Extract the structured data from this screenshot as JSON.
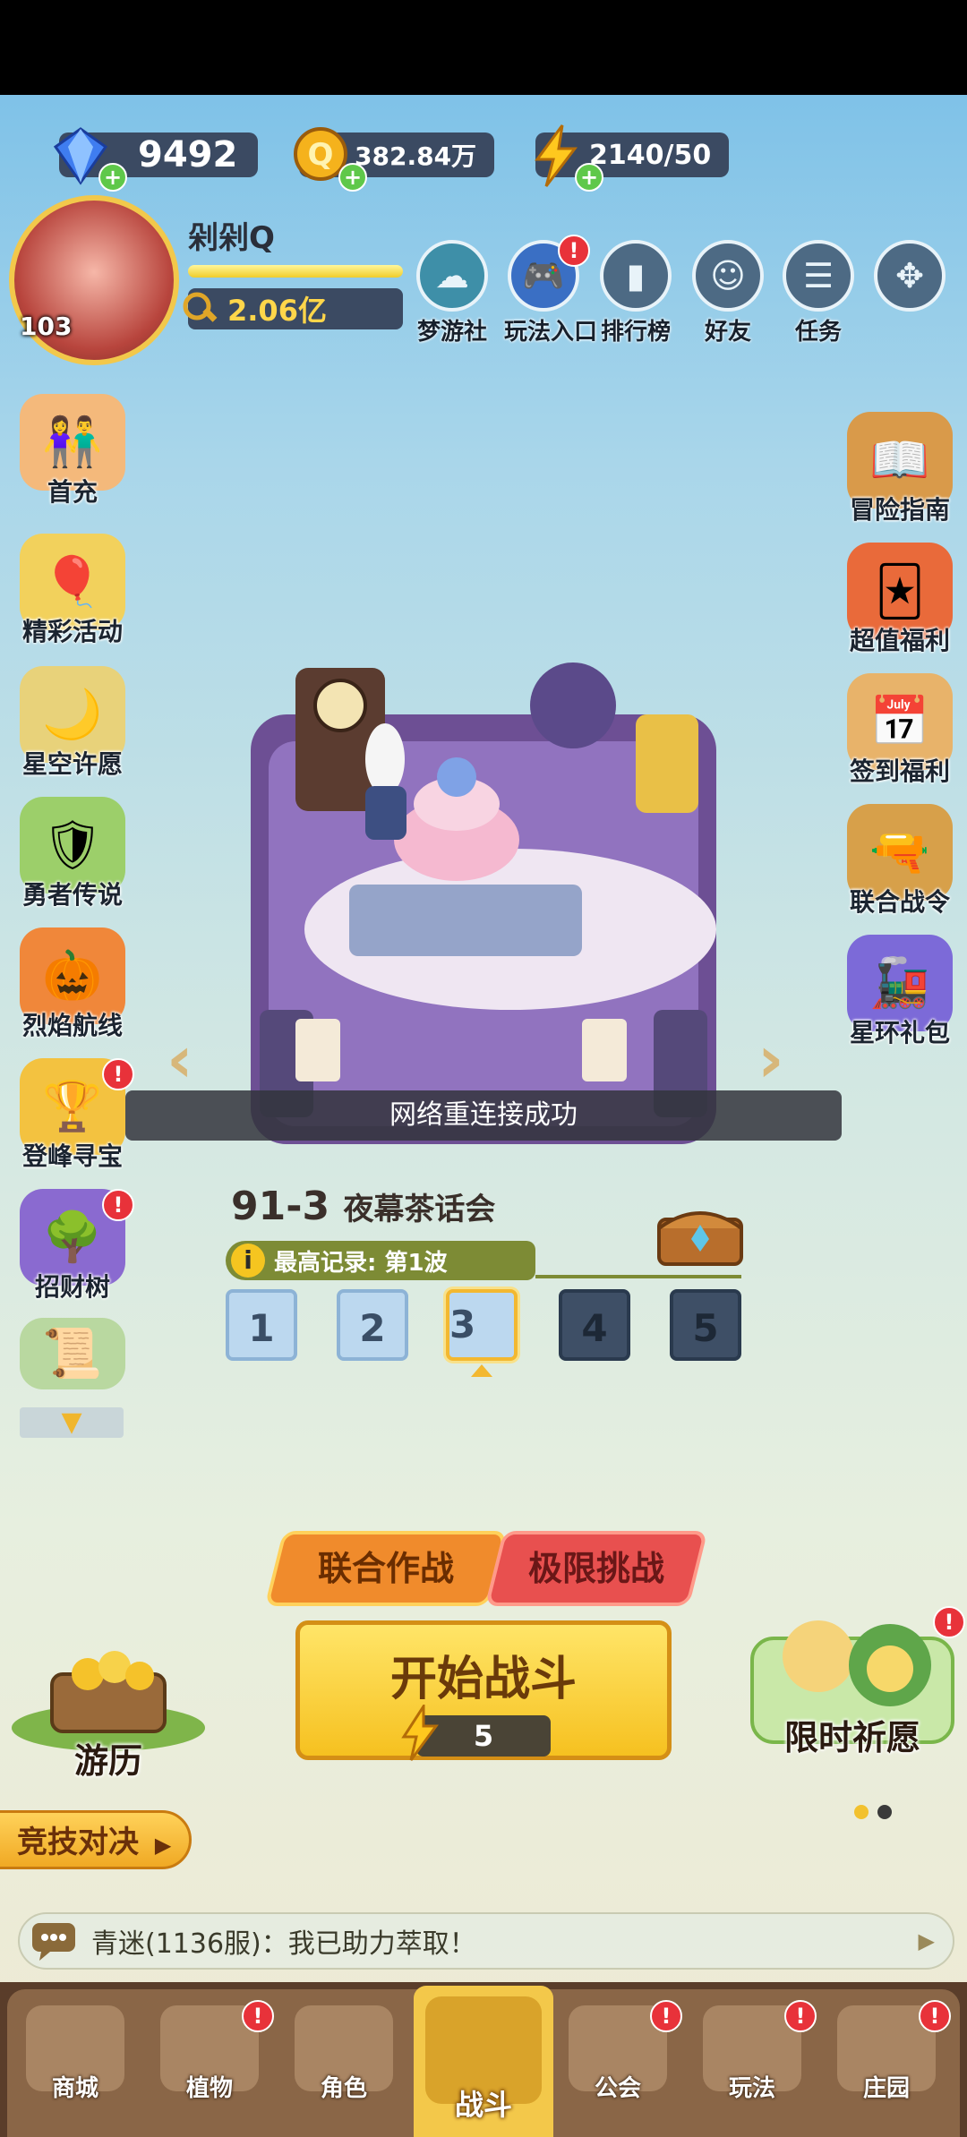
{
  "currencies": {
    "gems": "9492",
    "coins": "382.84万",
    "energy": "2140/50"
  },
  "player": {
    "name": "剁剁Q",
    "level": "103",
    "power": "2.06亿"
  },
  "top_menu": [
    {
      "label": "梦游社",
      "badge": ""
    },
    {
      "label": "玩法入口",
      "badge": "!"
    },
    {
      "label": "排行榜",
      "badge": ""
    },
    {
      "label": "好友",
      "badge": ""
    },
    {
      "label": "任务",
      "badge": ""
    }
  ],
  "left_menu": [
    {
      "label": "首充",
      "badge": ""
    },
    {
      "label": "精彩活动",
      "badge": ""
    },
    {
      "label": "星空许愿",
      "badge": ""
    },
    {
      "label": "勇者传说",
      "badge": ""
    },
    {
      "label": "烈焰航线",
      "badge": ""
    },
    {
      "label": "登峰寻宝",
      "badge": "!"
    },
    {
      "label": "招财树",
      "badge": "!"
    }
  ],
  "right_menu": [
    {
      "label": "冒险指南"
    },
    {
      "label": "超值福利"
    },
    {
      "label": "签到福利"
    },
    {
      "label": "联合战令"
    },
    {
      "label": "星环礼包"
    }
  ],
  "toast": "网络重连接成功",
  "stage": {
    "id": "91-3",
    "name": "夜幕茶话会",
    "record": "最高记录: 第1波",
    "waves": [
      "1",
      "2",
      "3",
      "4",
      "5"
    ],
    "current_wave": "3"
  },
  "modes": {
    "coop": "联合作战",
    "challenge": "极限挑战"
  },
  "start": {
    "label": "开始战斗",
    "cost": "5"
  },
  "travel_label": "游历",
  "wish_label": "限时祈愿",
  "arena_label": "竞技对决",
  "chat": "青迷(1136服)：我已助力萃取！",
  "bottom_nav": [
    {
      "label": "商城",
      "badge": ""
    },
    {
      "label": "植物",
      "badge": "!"
    },
    {
      "label": "角色",
      "badge": ""
    },
    {
      "label": "战斗",
      "badge": ""
    },
    {
      "label": "公会",
      "badge": "!"
    },
    {
      "label": "玩法",
      "badge": "!"
    },
    {
      "label": "庄园",
      "badge": "!"
    }
  ],
  "colors": {
    "accent_yellow": "#f6c120",
    "badge_red": "#e8323a",
    "nav_brown": "#8a6647"
  }
}
